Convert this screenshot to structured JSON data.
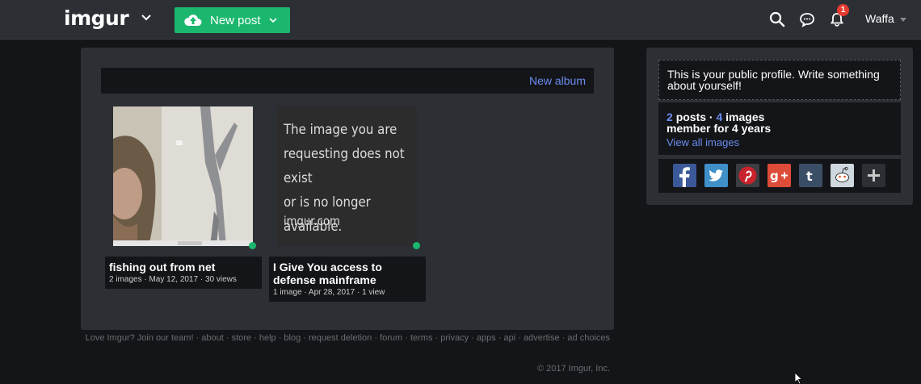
{
  "header": {
    "logo": "imgur",
    "new_post_label": "New post",
    "notification_count": "1",
    "username": "Waffa"
  },
  "main": {
    "new_album_label": "New album",
    "posts": [
      {
        "title": "fishing out from net",
        "meta": "2 images · May 12, 2017 · 30 views"
      },
      {
        "title": "I Give You access to defense mainframe",
        "meta": "1 image · Apr 28, 2017 · 1 view",
        "placeholder_text": [
          "The image you are",
          "requesting does not exist",
          "or is no longer available."
        ],
        "placeholder_domain": "imgur.com"
      }
    ]
  },
  "sidebar": {
    "bio_prompt": "This is your public profile. Write something about yourself!",
    "posts_count": "2",
    "posts_word": "posts",
    "images_count": "4",
    "images_word": "images",
    "member_for": "member for 4 years",
    "view_all": "View all images",
    "share_buttons": [
      "facebook-icon",
      "twitter-icon",
      "pinterest-icon",
      "google-plus-icon",
      "tumblr-icon",
      "reddit-icon",
      "plus-icon"
    ]
  },
  "footer": {
    "links": [
      "Love Imgur? Join our team!",
      "about",
      "store",
      "help",
      "blog",
      "request deletion",
      "forum",
      "terms",
      "privacy",
      "apps",
      "api",
      "advertise",
      "ad choices"
    ],
    "copyright": "© 2017 Imgur, Inc."
  },
  "colors": {
    "accent_green": "#1bb76e",
    "link_blue": "#6a8cf0",
    "badge_red": "#e53b2f",
    "panel": "#2c2f34",
    "background": "#141518"
  }
}
